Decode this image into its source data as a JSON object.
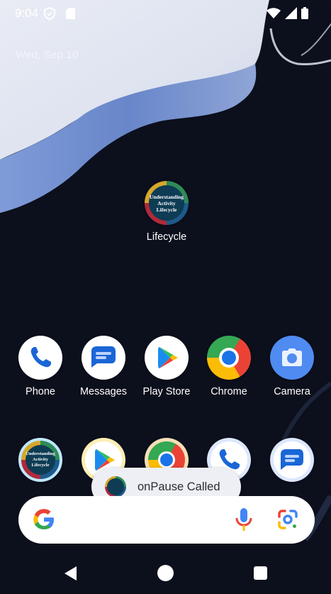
{
  "status_bar": {
    "time": "9:04",
    "icons": [
      "shield-icon",
      "sd-card-icon",
      "wifi-icon",
      "signal-icon",
      "battery-icon"
    ]
  },
  "date": "Wed, Sep 10",
  "home_app": {
    "label": "Lifecycle",
    "icon_text": "Understanding Activity Lifecycle"
  },
  "app_row": [
    {
      "label": "Phone",
      "icon": "phone-icon"
    },
    {
      "label": "Messages",
      "icon": "messages-icon"
    },
    {
      "label": "Play Store",
      "icon": "play-store-icon"
    },
    {
      "label": "Chrome",
      "icon": "chrome-icon"
    },
    {
      "label": "Camera",
      "icon": "camera-icon"
    }
  ],
  "dock": {
    "lifecycle_icon_text": "Understanding Activity Lifecycle",
    "icons": [
      "lifecycle-icon",
      "play-store-icon",
      "chrome-icon",
      "phone-icon",
      "messages-icon"
    ]
  },
  "toast": {
    "message": "onPause Called"
  },
  "search_bar": {
    "icons": [
      "google-g-icon",
      "microphone-icon",
      "google-lens-icon"
    ]
  },
  "navigation_bar": {
    "buttons": [
      "back-button",
      "home-button",
      "recents-button"
    ]
  },
  "colors": {
    "wallpaper_dark": "#0c0f1c",
    "wallpaper_light": "#e8ecf7",
    "wallpaper_blue": "#6f90d6",
    "toast_bg": "#eeeff4"
  }
}
